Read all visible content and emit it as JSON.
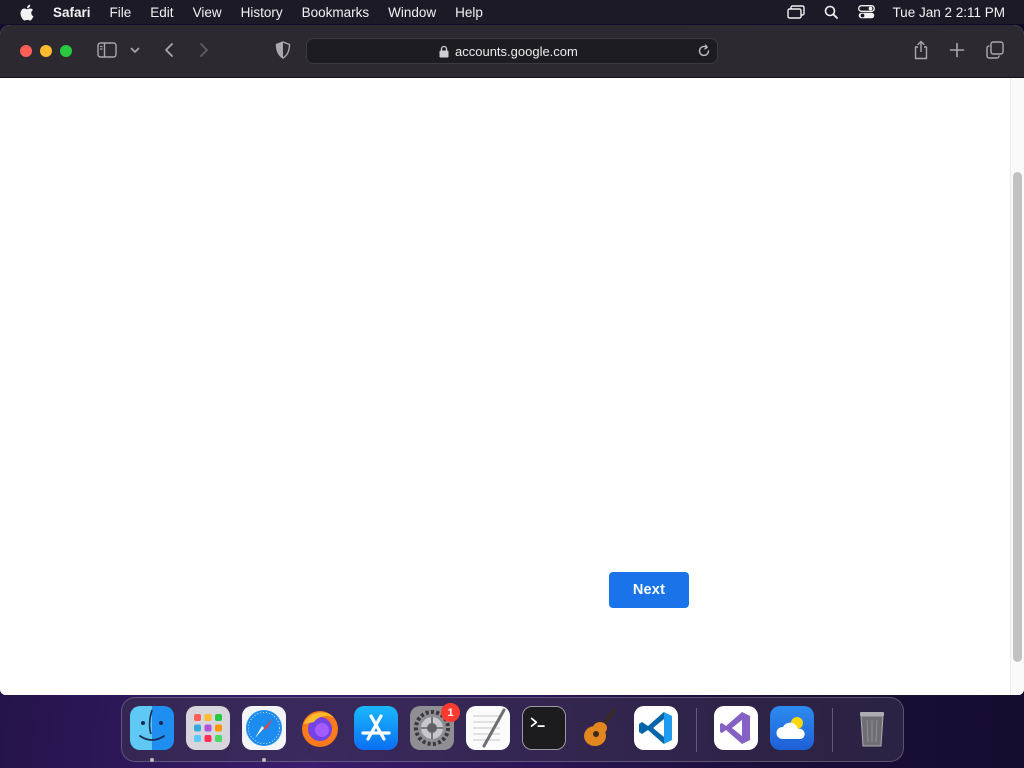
{
  "menubar": {
    "app_name": "Safari",
    "items": [
      "File",
      "Edit",
      "View",
      "History",
      "Bookmarks",
      "Window",
      "Help"
    ],
    "clock": "Tue Jan 2  2:11 PM",
    "status_icons": [
      "screen-mirroring-icon",
      "spotlight-search-icon",
      "control-center-icon"
    ]
  },
  "browser": {
    "url": "accounts.google.com",
    "secure": true
  },
  "page": {
    "next_label": "Next",
    "accent_color": "#1a73e8"
  },
  "dock": {
    "apps": [
      {
        "name": "Finder",
        "icon": "finder-icon",
        "running": true
      },
      {
        "name": "Launchpad",
        "icon": "launchpad-icon",
        "running": false
      },
      {
        "name": "Safari",
        "icon": "safari-icon",
        "running": true
      },
      {
        "name": "Firefox",
        "icon": "firefox-icon",
        "running": false
      },
      {
        "name": "App Store",
        "icon": "app-store-icon",
        "running": false
      },
      {
        "name": "System Settings",
        "icon": "system-settings-icon",
        "running": false,
        "badge": "1"
      },
      {
        "name": "TextEdit",
        "icon": "textedit-icon",
        "running": false
      },
      {
        "name": "Terminal",
        "icon": "terminal-icon",
        "running": false
      },
      {
        "name": "GarageBand",
        "icon": "garageband-icon",
        "running": false
      },
      {
        "name": "Visual Studio Code",
        "icon": "vscode-icon",
        "running": false
      },
      {
        "name": "Visual Studio",
        "icon": "visual-studio-icon",
        "running": false
      },
      {
        "name": "Weather",
        "icon": "weather-icon",
        "running": false
      },
      {
        "name": "Trash",
        "icon": "trash-icon",
        "running": false
      }
    ]
  }
}
